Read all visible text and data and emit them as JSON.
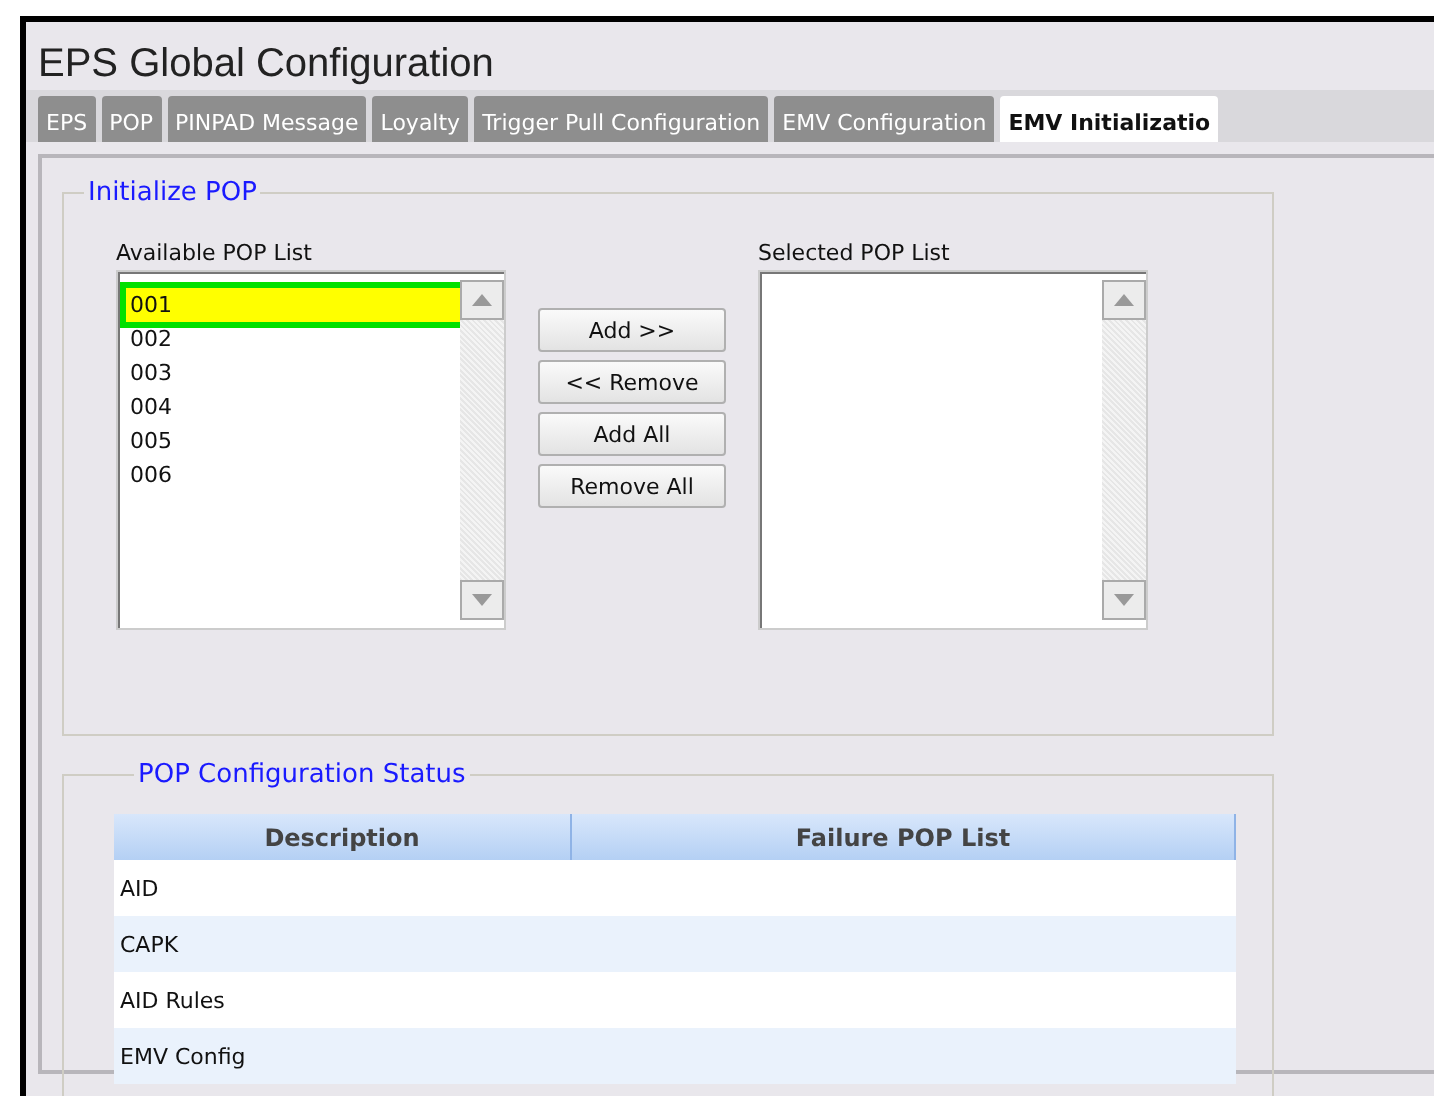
{
  "window": {
    "title": "EPS Global Configuration"
  },
  "tabs": [
    {
      "label": "EPS",
      "selected": false
    },
    {
      "label": "POP",
      "selected": false
    },
    {
      "label": "PINPAD Message",
      "selected": false
    },
    {
      "label": "Loyalty",
      "selected": false
    },
    {
      "label": "Trigger Pull Configuration",
      "selected": false
    },
    {
      "label": "EMV Configuration",
      "selected": false
    },
    {
      "label": "EMV Initializatio",
      "selected": true
    }
  ],
  "initialize_pop": {
    "legend": "Initialize POP",
    "available_list": {
      "label": "Available POP List",
      "items": [
        {
          "label": "001",
          "selected": true
        },
        {
          "label": "002",
          "selected": false
        },
        {
          "label": "003",
          "selected": false
        },
        {
          "label": "004",
          "selected": false
        },
        {
          "label": "005",
          "selected": false
        },
        {
          "label": "006",
          "selected": false
        }
      ]
    },
    "buttons": [
      "Add >>",
      "<< Remove",
      "Add All",
      "Remove All"
    ],
    "selected_list": {
      "label": "Selected POP List"
    }
  },
  "status": {
    "legend": "POP Configuration Status",
    "table": {
      "columns": [
        "Description",
        "Failure POP List"
      ],
      "rows": [
        {
          "description": "AID"
        },
        {
          "description": "CAPK"
        },
        {
          "description": "AID Rules"
        },
        {
          "description": "EMV Config"
        }
      ]
    }
  }
}
